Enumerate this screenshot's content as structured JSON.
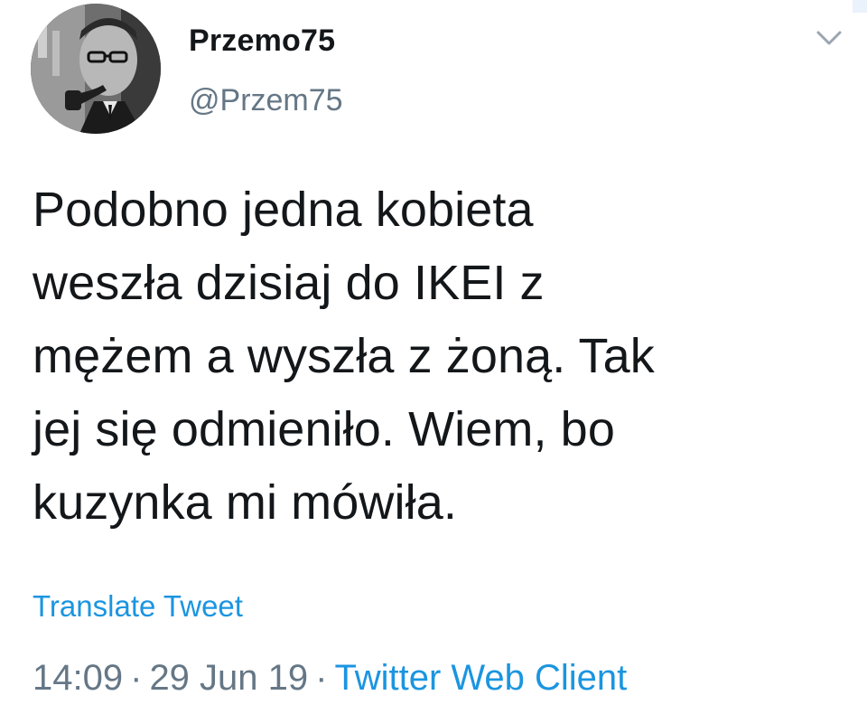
{
  "user": {
    "display_name": "Przemo75",
    "handle": "@Przem75",
    "avatar": "profile-photo-man-with-pipe-bw"
  },
  "tweet": {
    "text": "Podobno jedna kobieta\nweszła dzisiaj do IKEI z\nmężem a wyszła z żoną. Tak\njej się odmieniło. Wiem, bo\nkuzynka mi mówiła.",
    "translate_label": "Translate Tweet",
    "time": "14:09",
    "separator": "·",
    "date": "29 Jun 19",
    "client": "Twitter Web Client"
  },
  "icons": {
    "menu": "chevron-down-icon"
  },
  "colors": {
    "text": "#14171a",
    "muted": "#657786",
    "link": "#1b95e0",
    "background": "#ffffff"
  }
}
